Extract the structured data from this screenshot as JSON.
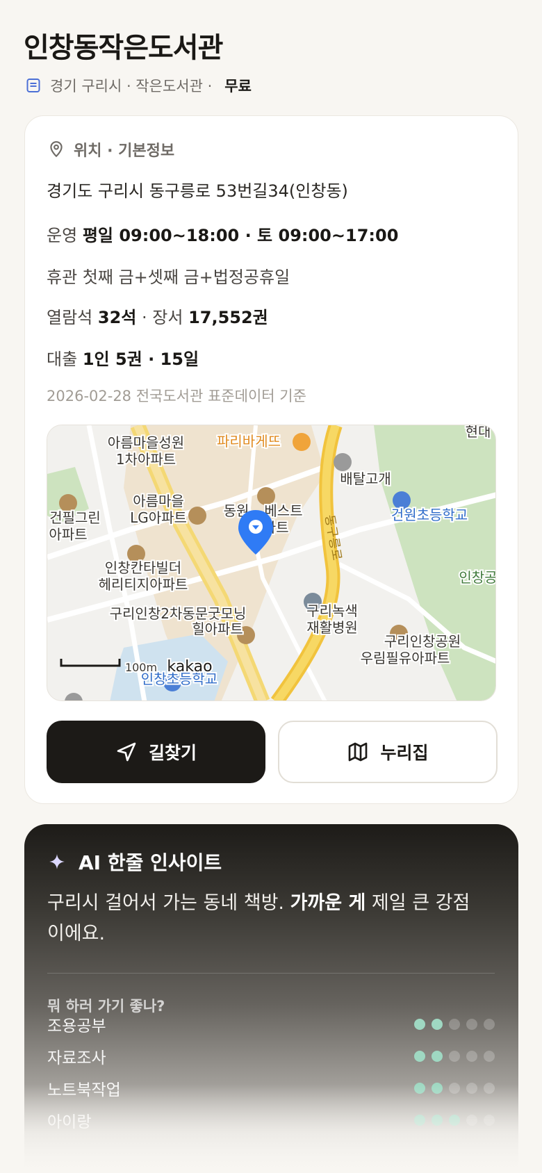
{
  "header": {
    "title": "인창동작은도서관",
    "meta": "경기 구리시 · 작은도서관 ·",
    "fee": "무료"
  },
  "info": {
    "section_title": "위치 · 기본정보",
    "address": "경기도 구리시 동구릉로 53번길34(인창동)",
    "hours_label": "운영",
    "hours_value": "평일 09:00~18:00 · 토 09:00~17:00",
    "closed": "휴관 첫째 금+셋째 금+법정공휴일",
    "seats_label": "열람석",
    "seats_value": "32석",
    "books_sep": " · 장서 ",
    "books_value": "17,552권",
    "loan_label": "대출",
    "loan_value": "1인 5권 · 15일",
    "source": "2026-02-28 전국도서관 표준데이터 기준"
  },
  "map": {
    "labels": {
      "a1": "아름마을성원",
      "a2": "1차아파트",
      "b": "파리바게뜨",
      "c1": "현대",
      "d": "배탈고개",
      "e1": "아름마을",
      "e2": "LG아파트",
      "f1": "건필그린",
      "f2": "아파트",
      "g1": "동원",
      "g2": "베스트",
      "g3": "아파트",
      "h": "건원초등학교",
      "i1": "인창칸타빌더",
      "i2": "헤리티지아파트",
      "j": "인창공",
      "k1": "구리녹색",
      "k2": "재활병원",
      "l1": "구리인창2차동문굿모닝",
      "l2": "힐아파트",
      "m1": "구리인창공원",
      "m2": "우림필유아파트",
      "road": "동구릉로",
      "school2": "인창초등학교",
      "scale": "100m",
      "brand": "kakao"
    }
  },
  "buttons": {
    "directions": "길찾기",
    "nuri": "누리집"
  },
  "ai": {
    "title": "AI 한줄 인사이트",
    "text_pre": "구리시 걸어서 가는 동네 책방. ",
    "text_bold": "가까운 게",
    "text_post": " 제일 큰 강점이에요.",
    "subtitle": "뭐 하러 가기 좋나?",
    "activities": [
      {
        "name": "조용공부",
        "level": 2,
        "max": 5
      },
      {
        "name": "자료조사",
        "level": 2,
        "max": 5
      },
      {
        "name": "노트북작업",
        "level": 2,
        "max": 5
      },
      {
        "name": "아이랑",
        "level": 3,
        "max": 5
      }
    ]
  },
  "colors": {
    "pin": "#2f7bf5",
    "road": "#f5c842",
    "dot_on": "#9fd8c2",
    "primary": "#1c1a17"
  }
}
